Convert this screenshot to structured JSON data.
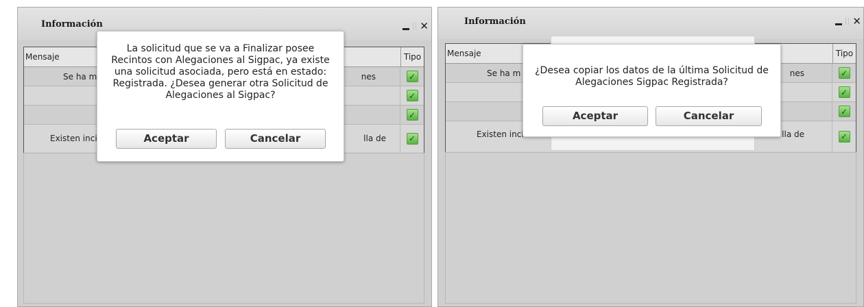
{
  "left": {
    "title": "Información",
    "grid": {
      "header_message": "Mensaje",
      "header_type": "Tipo",
      "rows": [
        {
          "left": "Se ha m",
          "right": "nes"
        },
        {
          "left": "",
          "right": ""
        },
        {
          "left": "",
          "right": ""
        },
        {
          "left": "Existen inci",
          "right": "lla de"
        }
      ]
    },
    "dialog": {
      "message": "La solicitud que se va a Finalizar posee Recintos con Alegaciones al Sigpac, ya existe una solicitud asociada, pero está en estado: Registrada. ¿Desea generar otra Solicitud de Alegaciones al Sigpac?",
      "accept_label": "Aceptar",
      "cancel_label": "Cancelar"
    }
  },
  "right": {
    "title": "Información",
    "grid": {
      "header_message": "Mensaje",
      "header_type": "Tipo",
      "rows": [
        {
          "left": "Se ha m",
          "right": "nes"
        },
        {
          "left": "",
          "right": ""
        },
        {
          "left": "",
          "right": ""
        },
        {
          "left": "Existen inci",
          "right": "lla de"
        }
      ]
    },
    "dialog": {
      "message": "¿Desea copiar los datos de la última Solicitud de Alegaciones Sigpac Registrada?",
      "accept_label": "Aceptar",
      "cancel_label": "Cancelar"
    }
  },
  "icons": {
    "status": "check-icon",
    "window_min": "minimize-icon",
    "window_close": "close-icon"
  },
  "colors": {
    "panel_bg": "#cfcfcf",
    "check_green": "#58b243"
  }
}
